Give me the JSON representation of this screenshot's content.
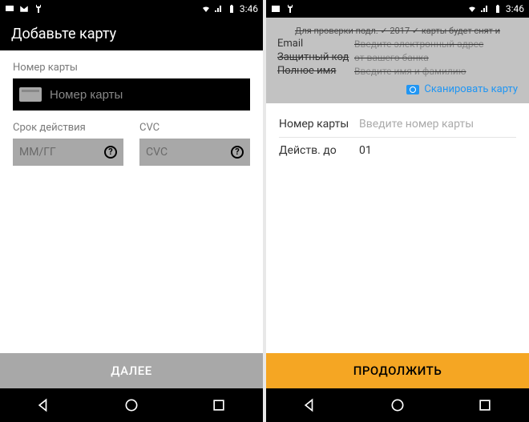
{
  "status": {
    "time": "3:46"
  },
  "left": {
    "title": "Добавьте карту",
    "cardLabel": "Номер карты",
    "cardPlaceholder": "Номер карты",
    "expiryLabel": "Срок действия",
    "expiryPlaceholder": "ММ/ГГ",
    "cvcLabel": "CVC",
    "cvcPlaceholder": "CVC",
    "cta": "ДАЛЕЕ"
  },
  "right": {
    "topStrike": "Для проверки подл. ✓ 2017 ✓ карты будет снят и",
    "emailLabel": "Email",
    "emailHint": "Введите электронный адрес",
    "codeLabel": "Защитный код",
    "codeHint": "от вашего банка",
    "nameLabel": "Полное имя",
    "nameHint": "Введите имя и фамилию",
    "scan": "Сканировать карту",
    "cardLabel": "Номер карты",
    "cardPlaceholder": "Введите номер карты",
    "validLabel": "Действ. до",
    "validValue": "01",
    "cta": "ПРОДОЛЖИТЬ"
  }
}
